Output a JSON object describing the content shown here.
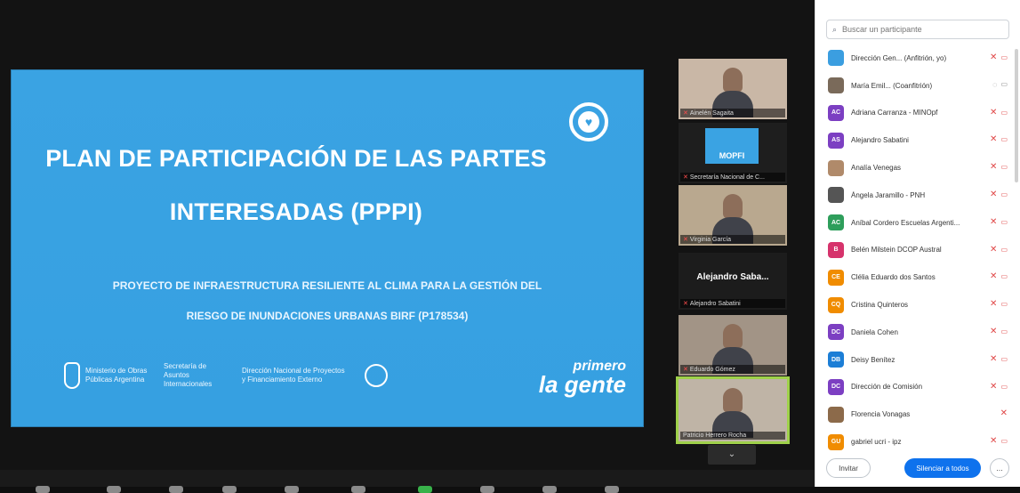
{
  "slide": {
    "title_line1": "PLAN DE PARTICIPACIÓN DE LAS PARTES",
    "title_line2": "INTERESADAS (PPPI)",
    "subtitle_line1": "PROYECTO DE INFRAESTRUCTURA RESILIENTE AL CLIMA PARA LA GESTIÓN DEL",
    "subtitle_line2": "RIESGO DE INUNDACIONES URBANAS BIRF (P178534)",
    "logo1_text": "Ministerio de Obras Públicas Argentina",
    "logo2_text": "Secretaría de Asuntos Internacionales",
    "logo3_text": "Dirección Nacional de Proyectos y Financiamiento Externo",
    "brand_line1": "primero",
    "brand_line2": "la gente",
    "brand_color": "#3aa3e3"
  },
  "video_tiles": [
    {
      "name": "Ainelén Sagaita"
    },
    {
      "name": "Secretaría Nacional de C...",
      "logo": "MOPFI"
    },
    {
      "name": "Virginia García"
    },
    {
      "name": "Alejandro Sabatini",
      "big_label": "Alejandro Saba..."
    },
    {
      "name": "Eduardo Gómez"
    },
    {
      "name": "Patricio Herrero Rocha"
    }
  ],
  "panel": {
    "search_placeholder": "Buscar un participante",
    "participants": [
      {
        "name": "Dirección Gen... (Anfitrión, yo)",
        "initials": "",
        "color": "#3b9ee0"
      },
      {
        "name": "María Emil... (Coanfitrión)",
        "initials": "",
        "color": "#7a6a5a"
      },
      {
        "name": "Adriana Carranza - MINOpf",
        "initials": "AC",
        "color": "#7c3fc2"
      },
      {
        "name": "Alejandro Sabatini",
        "initials": "AS",
        "color": "#7c3fc2"
      },
      {
        "name": "Analía Venegas",
        "initials": "",
        "color": "#b08a6a"
      },
      {
        "name": "Ángela Jaramillo - PNH",
        "initials": "",
        "color": "#555"
      },
      {
        "name": "Aníbal Cordero Escuelas Argenti...",
        "initials": "AC",
        "color": "#2e9e5b"
      },
      {
        "name": "Belén Milstein DCOP Austral",
        "initials": "B",
        "color": "#d6336c"
      },
      {
        "name": "Clélia Eduardo dos Santos",
        "initials": "CE",
        "color": "#f08c00"
      },
      {
        "name": "Cristina Quinteros",
        "initials": "CQ",
        "color": "#f08c00"
      },
      {
        "name": "Daniela Cohen",
        "initials": "DC",
        "color": "#7c3fc2"
      },
      {
        "name": "Deisy Benítez",
        "initials": "DB",
        "color": "#1c7ed6"
      },
      {
        "name": "Dirección de Comisión",
        "initials": "DC",
        "color": "#7c3fc2"
      },
      {
        "name": "Florencia Vonagas",
        "initials": "",
        "color": "#8c6a4a"
      },
      {
        "name": "gabriel ucri - ipz",
        "initials": "GU",
        "color": "#f08c00"
      }
    ],
    "invite_label": "Invitar",
    "mute_all_label": "Silenciar a todos",
    "more_label": "..."
  },
  "scroll_down_label": "⌄"
}
